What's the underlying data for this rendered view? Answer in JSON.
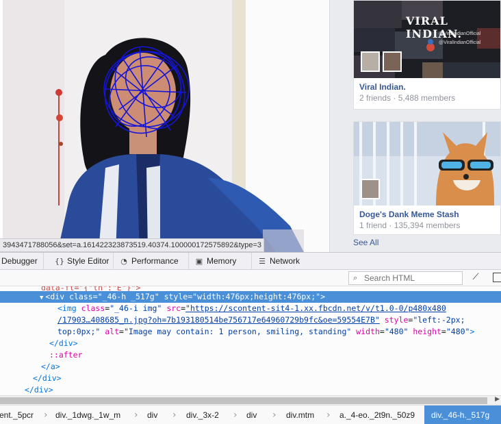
{
  "status_url": "3943471788056&set=a.161422323873519.40374.100000172575892&type=3",
  "groups": [
    {
      "name": "Viral Indian.",
      "stats": "2 friends · 5,488 members",
      "cover_title": "VIRAL INDIAN.",
      "cover_handles": [
        "@ViralIndianOfficial",
        "@ViralIndianOfficial"
      ]
    },
    {
      "name": "Doge's Dank Meme Stash",
      "stats": "1 friend · 135,394 members"
    }
  ],
  "see_all": "See All",
  "devtools": {
    "tabs": [
      {
        "label": "Debugger",
        "icon": "debugger-icon"
      },
      {
        "label": "Style Editor",
        "icon": "braces-icon"
      },
      {
        "label": "Performance",
        "icon": "gauge-icon"
      },
      {
        "label": "Memory",
        "icon": "memory-chip-icon"
      },
      {
        "label": "Network",
        "icon": "network-list-icon"
      }
    ],
    "search_placeholder": "Search HTML",
    "markup_lines": {
      "l0": "data-ft=\"{\"tn\":\"E\"}\">",
      "l1_tag_open": "<div",
      "l1_class_attr": "class",
      "l1_class_val": "\"_46-h _517g\"",
      "l1_style_attr": "style",
      "l1_style_val": "\"width:476px;height:476px;\"",
      "l1_close": ">",
      "l2_tag_open": "<img",
      "l2_class_attr": "class",
      "l2_class_val": "\"_46-i img\"",
      "l2_src_attr": "src",
      "l2_src_val": "\"https://scontent-sit4-1.xx.fbcdn.net/v/t1.0-0/p480x480",
      "l3_src_cont": "/17903…408685_n.jpg?oh=7b193180514be756717e64960729b9fc&oe=59554E7B\"",
      "l3_style_attr": "style",
      "l3_style_val": "\"left:-2px;",
      "l4_style_cont": "top:0px;\"",
      "l4_alt_attr": "alt",
      "l4_alt_val": "\"Image may contain: 1 person, smiling, standing\"",
      "l4_width_attr": "width",
      "l4_width_val": "\"480\"",
      "l4_height_attr": "height",
      "l4_height_val": "\"480\"",
      "l4_close": ">",
      "l5": "</div>",
      "l6": "::after",
      "l7": "</a>",
      "l8": "</div>",
      "l9": "</div>"
    },
    "breadcrumbs": [
      "ent._5pcr",
      "div._1dwg._1w_m",
      "div",
      "div._3x-2",
      "div",
      "div.mtm",
      "a._4-eo._2t9n._50z9",
      "div._46-h._517g"
    ]
  },
  "colors": {
    "selection": "#4a90d9",
    "fb_link": "#365899",
    "tag": "#0074e8",
    "attr": "#dd00a9"
  }
}
